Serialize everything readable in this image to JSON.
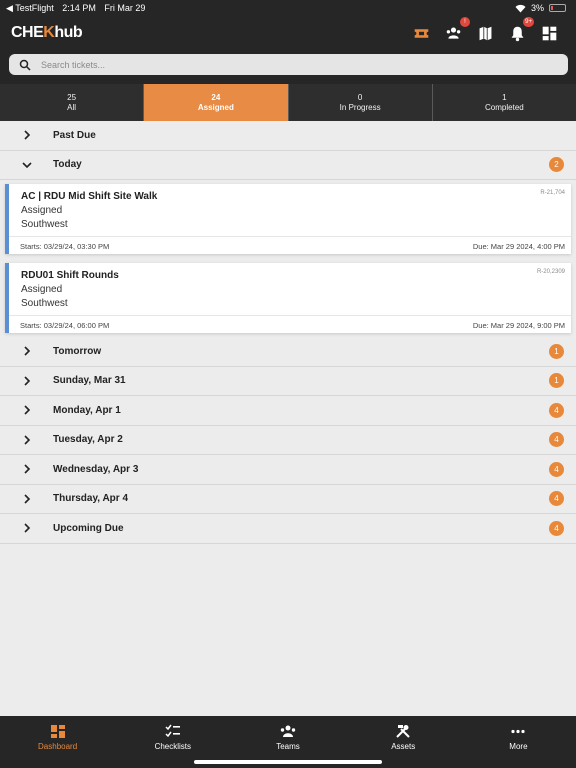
{
  "status": {
    "back_app": "◀ TestFlight",
    "time": "2:14 PM",
    "date": "Fri Mar 29",
    "battery": "3%"
  },
  "header": {
    "logo_pre": "CHE",
    "logo_k": "K",
    "logo_post": "hub",
    "icons": [
      "ticket-icon",
      "team-alert-icon",
      "map-icon",
      "bell-icon",
      "dashboard-grid-icon"
    ],
    "team_badge": "!",
    "bell_badge": "9+"
  },
  "search": {
    "placeholder": "Search tickets..."
  },
  "tabs": [
    {
      "count": "25",
      "label": "All"
    },
    {
      "count": "24",
      "label": "Assigned"
    },
    {
      "count": "0",
      "label": "In Progress"
    },
    {
      "count": "1",
      "label": "Completed"
    }
  ],
  "sections": {
    "past_due": {
      "title": "Past Due"
    },
    "today": {
      "title": "Today",
      "count": "2"
    },
    "tomorrow": {
      "title": "Tomorrow",
      "count": "1"
    },
    "sun": {
      "title": "Sunday, Mar 31",
      "count": "1"
    },
    "mon": {
      "title": "Monday, Apr 1",
      "count": "4"
    },
    "tue": {
      "title": "Tuesday, Apr 2",
      "count": "4"
    },
    "wed": {
      "title": "Wednesday, Apr 3",
      "count": "4"
    },
    "thu": {
      "title": "Thursday, Apr 4",
      "count": "4"
    },
    "upcoming": {
      "title": "Upcoming Due",
      "count": "4"
    }
  },
  "tickets": [
    {
      "title": "AC | RDU Mid Shift Site Walk",
      "ref": "R-21,704",
      "status": "Assigned",
      "region": "Southwest",
      "starts": "Starts: 03/29/24, 03:30 PM",
      "due": "Due: Mar 29 2024, 4:00 PM"
    },
    {
      "title": "RDU01 Shift Rounds",
      "ref": "R-20,2309",
      "status": "Assigned",
      "region": "Southwest",
      "starts": "Starts: 03/29/24, 06:00 PM",
      "due": "Due: Mar 29 2024, 9:00 PM"
    }
  ],
  "bottom_nav": [
    {
      "label": "Dashboard",
      "icon": "dashboard-icon"
    },
    {
      "label": "Checklists",
      "icon": "checklist-icon"
    },
    {
      "label": "Teams",
      "icon": "teams-icon"
    },
    {
      "label": "Assets",
      "icon": "tools-icon"
    },
    {
      "label": "More",
      "icon": "more-icon"
    }
  ],
  "colors": {
    "accent": "#e8883a",
    "header_bg": "#262626",
    "card_stripe": "#5b8fd4",
    "badge_red": "#e0473d"
  }
}
